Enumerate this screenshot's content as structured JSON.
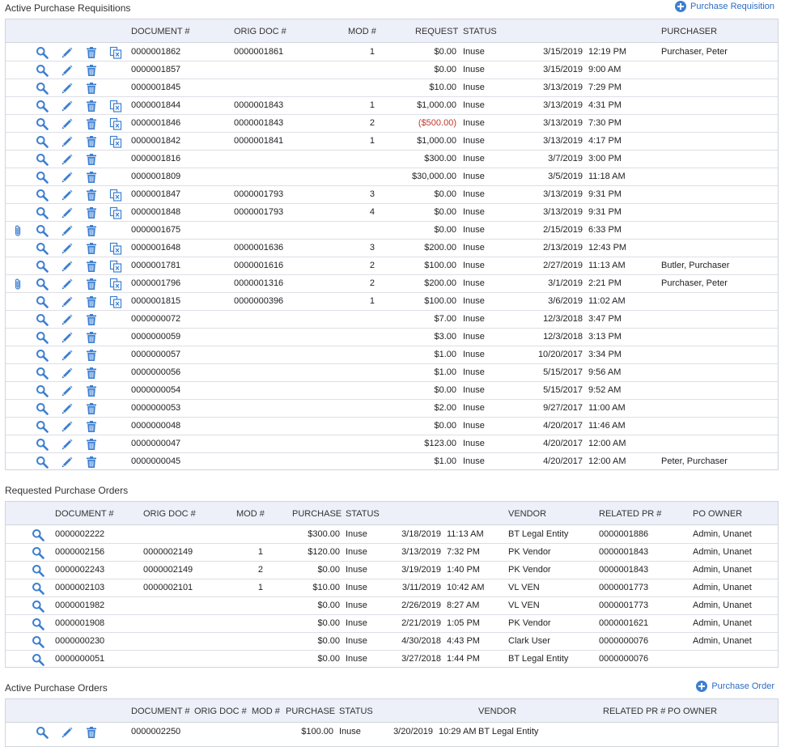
{
  "requisitions": {
    "title": "Active Purchase Requisitions",
    "add_label": "Purchase Requisition",
    "columns": [
      "DOCUMENT #",
      "ORIG DOC #",
      "MOD #",
      "REQUEST",
      "STATUS",
      "PURCHASER"
    ],
    "rows": [
      {
        "doc": "0000001862",
        "orig": "0000001861",
        "mod": "1",
        "request": "$0.00",
        "status": "Inuse",
        "date": "3/15/2019",
        "time": "12:19 PM",
        "purchaser": "Purchaser, Peter",
        "clip": false,
        "copy": true
      },
      {
        "doc": "0000001857",
        "orig": "",
        "mod": "",
        "request": "$0.00",
        "status": "Inuse",
        "date": "3/15/2019",
        "time": "9:00 AM",
        "purchaser": "",
        "clip": false,
        "copy": false
      },
      {
        "doc": "0000001845",
        "orig": "",
        "mod": "",
        "request": "$10.00",
        "status": "Inuse",
        "date": "3/13/2019",
        "time": "7:29 PM",
        "purchaser": "",
        "clip": false,
        "copy": false
      },
      {
        "doc": "0000001844",
        "orig": "0000001843",
        "mod": "1",
        "request": "$1,000.00",
        "status": "Inuse",
        "date": "3/13/2019",
        "time": "4:31 PM",
        "purchaser": "",
        "clip": false,
        "copy": true
      },
      {
        "doc": "0000001846",
        "orig": "0000001843",
        "mod": "2",
        "request": "($500.00)",
        "status": "Inuse",
        "date": "3/13/2019",
        "time": "7:30 PM",
        "purchaser": "",
        "clip": false,
        "copy": true,
        "negative": true
      },
      {
        "doc": "0000001842",
        "orig": "0000001841",
        "mod": "1",
        "request": "$1,000.00",
        "status": "Inuse",
        "date": "3/13/2019",
        "time": "4:17 PM",
        "purchaser": "",
        "clip": false,
        "copy": true
      },
      {
        "doc": "0000001816",
        "orig": "",
        "mod": "",
        "request": "$300.00",
        "status": "Inuse",
        "date": "3/7/2019",
        "time": "3:00 PM",
        "purchaser": "",
        "clip": false,
        "copy": false
      },
      {
        "doc": "0000001809",
        "orig": "",
        "mod": "",
        "request": "$30,000.00",
        "status": "Inuse",
        "date": "3/5/2019",
        "time": "11:18 AM",
        "purchaser": "",
        "clip": false,
        "copy": false
      },
      {
        "doc": "0000001847",
        "orig": "0000001793",
        "mod": "3",
        "request": "$0.00",
        "status": "Inuse",
        "date": "3/13/2019",
        "time": "9:31 PM",
        "purchaser": "",
        "clip": false,
        "copy": true
      },
      {
        "doc": "0000001848",
        "orig": "0000001793",
        "mod": "4",
        "request": "$0.00",
        "status": "Inuse",
        "date": "3/13/2019",
        "time": "9:31 PM",
        "purchaser": "",
        "clip": false,
        "copy": true
      },
      {
        "doc": "0000001675",
        "orig": "",
        "mod": "",
        "request": "$0.00",
        "status": "Inuse",
        "date": "2/15/2019",
        "time": "6:33 PM",
        "purchaser": "",
        "clip": true,
        "copy": false
      },
      {
        "doc": "0000001648",
        "orig": "0000001636",
        "mod": "3",
        "request": "$200.00",
        "status": "Inuse",
        "date": "2/13/2019",
        "time": "12:43 PM",
        "purchaser": "",
        "clip": false,
        "copy": true
      },
      {
        "doc": "0000001781",
        "orig": "0000001616",
        "mod": "2",
        "request": "$100.00",
        "status": "Inuse",
        "date": "2/27/2019",
        "time": "11:13 AM",
        "purchaser": "Butler, Purchaser",
        "clip": false,
        "copy": true
      },
      {
        "doc": "0000001796",
        "orig": "0000001316",
        "mod": "2",
        "request": "$200.00",
        "status": "Inuse",
        "date": "3/1/2019",
        "time": "2:21 PM",
        "purchaser": "Purchaser, Peter",
        "clip": true,
        "copy": true
      },
      {
        "doc": "0000001815",
        "orig": "0000000396",
        "mod": "1",
        "request": "$100.00",
        "status": "Inuse",
        "date": "3/6/2019",
        "time": "11:02 AM",
        "purchaser": "",
        "clip": false,
        "copy": true
      },
      {
        "doc": "0000000072",
        "orig": "",
        "mod": "",
        "request": "$7.00",
        "status": "Inuse",
        "date": "12/3/2018",
        "time": "3:47 PM",
        "purchaser": "",
        "clip": false,
        "copy": false
      },
      {
        "doc": "0000000059",
        "orig": "",
        "mod": "",
        "request": "$3.00",
        "status": "Inuse",
        "date": "12/3/2018",
        "time": "3:13 PM",
        "purchaser": "",
        "clip": false,
        "copy": false
      },
      {
        "doc": "0000000057",
        "orig": "",
        "mod": "",
        "request": "$1.00",
        "status": "Inuse",
        "date": "10/20/2017",
        "time": "3:34 PM",
        "purchaser": "",
        "clip": false,
        "copy": false
      },
      {
        "doc": "0000000056",
        "orig": "",
        "mod": "",
        "request": "$1.00",
        "status": "Inuse",
        "date": "5/15/2017",
        "time": "9:56 AM",
        "purchaser": "",
        "clip": false,
        "copy": false
      },
      {
        "doc": "0000000054",
        "orig": "",
        "mod": "",
        "request": "$0.00",
        "status": "Inuse",
        "date": "5/15/2017",
        "time": "9:52 AM",
        "purchaser": "",
        "clip": false,
        "copy": false
      },
      {
        "doc": "0000000053",
        "orig": "",
        "mod": "",
        "request": "$2.00",
        "status": "Inuse",
        "date": "9/27/2017",
        "time": "11:00 AM",
        "purchaser": "",
        "clip": false,
        "copy": false
      },
      {
        "doc": "0000000048",
        "orig": "",
        "mod": "",
        "request": "$0.00",
        "status": "Inuse",
        "date": "4/20/2017",
        "time": "11:46 AM",
        "purchaser": "",
        "clip": false,
        "copy": false
      },
      {
        "doc": "0000000047",
        "orig": "",
        "mod": "",
        "request": "$123.00",
        "status": "Inuse",
        "date": "4/20/2017",
        "time": "12:00 AM",
        "purchaser": "",
        "clip": false,
        "copy": false
      },
      {
        "doc": "0000000045",
        "orig": "",
        "mod": "",
        "request": "$1.00",
        "status": "Inuse",
        "date": "4/20/2017",
        "time": "12:00 AM",
        "purchaser": "Peter, Purchaser",
        "clip": false,
        "copy": false
      }
    ]
  },
  "requested_pos": {
    "title": "Requested Purchase Orders",
    "columns": [
      "DOCUMENT #",
      "ORIG DOC #",
      "MOD #",
      "PURCHASE",
      "STATUS",
      "VENDOR",
      "RELATED PR #",
      "PO OWNER"
    ],
    "rows": [
      {
        "doc": "0000002222",
        "orig": "",
        "mod": "",
        "purchase": "$300.00",
        "status": "Inuse",
        "date": "3/18/2019",
        "time": "11:13 AM",
        "vendor": "BT Legal Entity",
        "related": "0000001886",
        "owner": "Admin, Unanet"
      },
      {
        "doc": "0000002156",
        "orig": "0000002149",
        "mod": "1",
        "purchase": "$120.00",
        "status": "Inuse",
        "date": "3/13/2019",
        "time": "7:32 PM",
        "vendor": "PK Vendor",
        "related": "0000001843",
        "owner": "Admin, Unanet"
      },
      {
        "doc": "0000002243",
        "orig": "0000002149",
        "mod": "2",
        "purchase": "$0.00",
        "status": "Inuse",
        "date": "3/19/2019",
        "time": "1:40 PM",
        "vendor": "PK Vendor",
        "related": "0000001843",
        "owner": "Admin, Unanet"
      },
      {
        "doc": "0000002103",
        "orig": "0000002101",
        "mod": "1",
        "purchase": "$10.00",
        "status": "Inuse",
        "date": "3/11/2019",
        "time": "10:42 AM",
        "vendor": "VL VEN",
        "related": "0000001773",
        "owner": "Admin, Unanet"
      },
      {
        "doc": "0000001982",
        "orig": "",
        "mod": "",
        "purchase": "$0.00",
        "status": "Inuse",
        "date": "2/26/2019",
        "time": "8:27 AM",
        "vendor": "VL VEN",
        "related": "0000001773",
        "owner": "Admin, Unanet"
      },
      {
        "doc": "0000001908",
        "orig": "",
        "mod": "",
        "purchase": "$0.00",
        "status": "Inuse",
        "date": "2/21/2019",
        "time": "1:05 PM",
        "vendor": "PK Vendor",
        "related": "0000001621",
        "owner": "Admin, Unanet"
      },
      {
        "doc": "0000000230",
        "orig": "",
        "mod": "",
        "purchase": "$0.00",
        "status": "Inuse",
        "date": "4/30/2018",
        "time": "4:43 PM",
        "vendor": "Clark User",
        "related": "0000000076",
        "owner": "Admin, Unanet"
      },
      {
        "doc": "0000000051",
        "orig": "",
        "mod": "",
        "purchase": "$0.00",
        "status": "Inuse",
        "date": "3/27/2018",
        "time": "1:44 PM",
        "vendor": "BT Legal Entity",
        "related": "0000000076",
        "owner": ""
      }
    ]
  },
  "active_pos": {
    "title": "Active Purchase Orders",
    "add_label": "Purchase Order",
    "columns": [
      "DOCUMENT #",
      "ORIG DOC #",
      "MOD #",
      "PURCHASE",
      "STATUS",
      "VENDOR",
      "RELATED PR #",
      "PO OWNER"
    ],
    "rows": [
      {
        "doc": "0000002250",
        "orig": "",
        "mod": "",
        "purchase": "$100.00",
        "status": "Inuse",
        "date": "3/20/2019",
        "time": "10:29 AM",
        "vendor": "BT Legal Entity",
        "related": "",
        "owner": ""
      }
    ]
  },
  "colors": {
    "accent": "#2b6cc4",
    "icon_blue": "#3d7fd1",
    "header_bg": "#edf0f9",
    "negative": "#c0392b"
  }
}
